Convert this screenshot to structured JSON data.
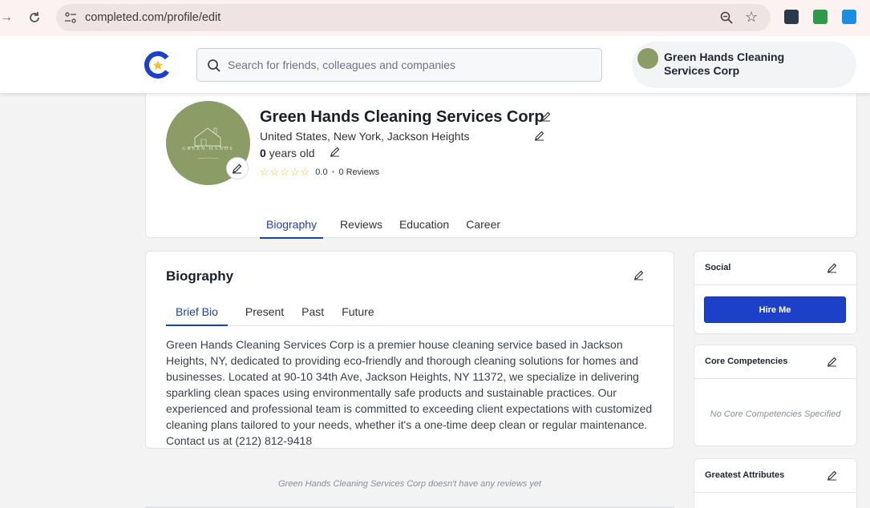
{
  "browser": {
    "url": "completed.com/profile/edit"
  },
  "header": {
    "search_placeholder": "Search for friends, colleagues and companies",
    "account_name": "Green Hands Cleaning Services Corp"
  },
  "profile": {
    "name": "Green Hands Cleaning Services Corp",
    "location": "United States, New York, Jackson Heights",
    "age_value": "0",
    "age_suffix": " years old",
    "rating_score": "0.0",
    "rating_separator": "•",
    "reviews_count": "0 Reviews",
    "stars": "☆☆☆☆☆",
    "photo_text": "GREEN HANDS",
    "tabs": [
      {
        "label": "Biography"
      },
      {
        "label": "Reviews"
      },
      {
        "label": "Education"
      },
      {
        "label": "Career"
      }
    ]
  },
  "biography": {
    "title": "Biography",
    "subtabs": [
      {
        "label": "Brief Bio"
      },
      {
        "label": "Present"
      },
      {
        "label": "Past"
      },
      {
        "label": "Future"
      }
    ],
    "text": "Green Hands Cleaning Services Corp is a premier house cleaning service based in Jackson Heights, NY, dedicated to providing eco-friendly and thorough cleaning solutions for homes and businesses. Located at 90-10 34th Ave, Jackson Heights, NY 11372, we specialize in delivering sparkling clean spaces using environmentally safe products and sustainable practices. Our experienced and professional team is committed to exceeding client expectations with customized cleaning plans tailored to your needs, whether it's a one-time deep clean or regular maintenance. Contact us at (212) 812-9418"
  },
  "reviews_empty": "Green Hands Cleaning Services Corp doesn't have any reviews yet",
  "sidebar": {
    "social_title": "Social",
    "hire_label": "Hire Me",
    "core_title": "Core Competencies",
    "core_empty": "No Core Competencies Specified",
    "attributes_title": "Greatest Attributes"
  },
  "colors": {
    "accent": "#1e40af",
    "button": "#1d40c8",
    "avatar_green": "#8b9c67",
    "star": "#f2c12e"
  },
  "icons": [
    "forward-icon",
    "reload-icon",
    "site-settings-icon",
    "zoom-icon",
    "star-icon",
    "search-icon",
    "pencil-icon"
  ]
}
